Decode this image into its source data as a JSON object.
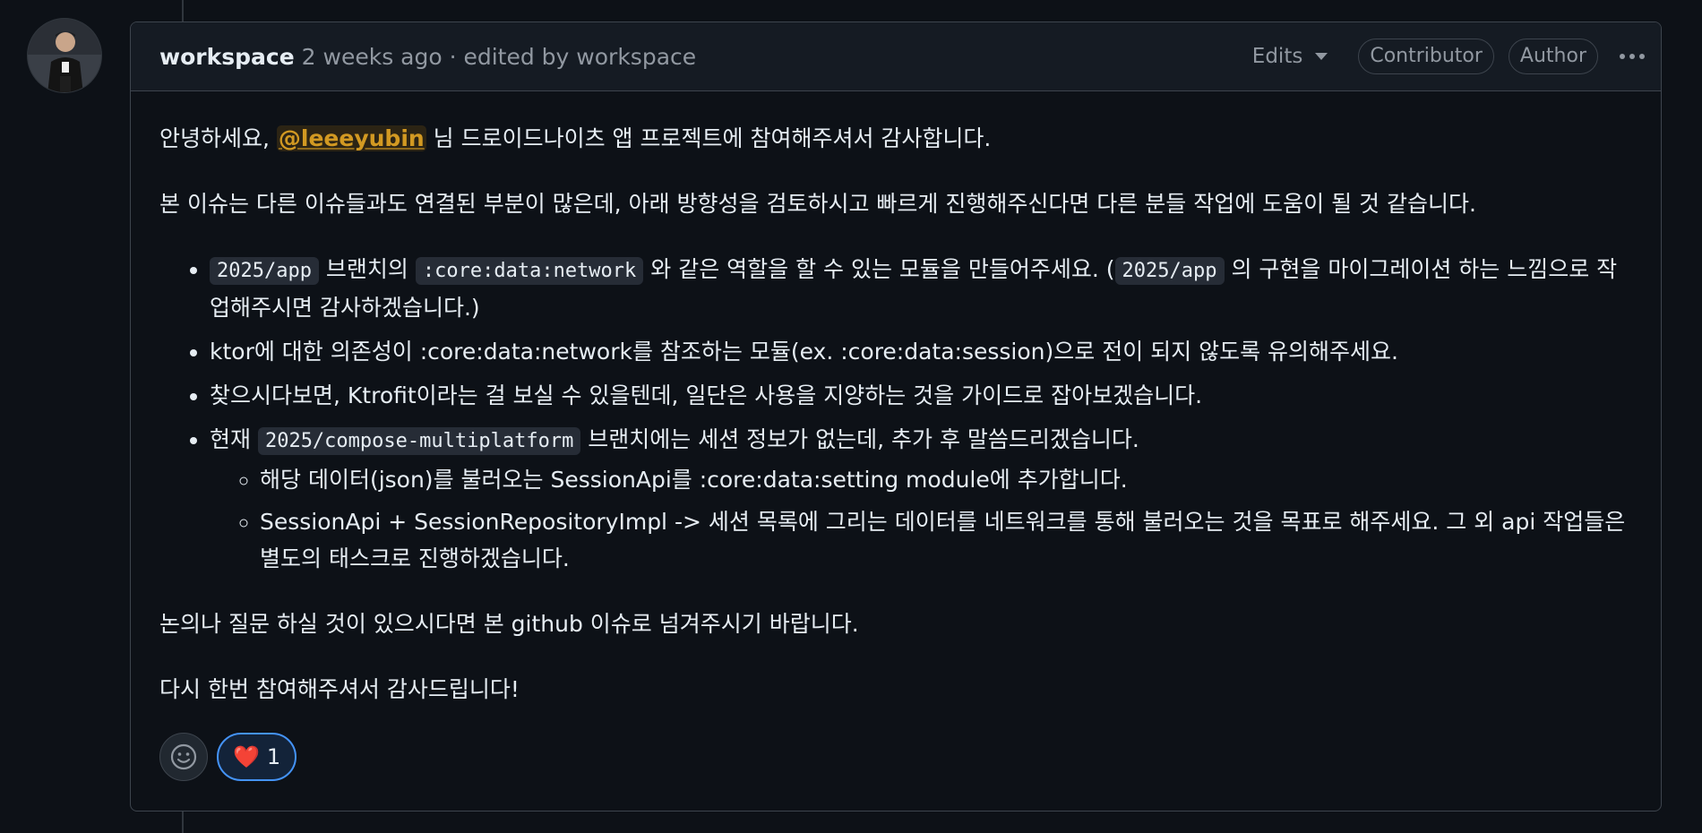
{
  "header": {
    "author": "workspace",
    "meta": "2 weeks ago · edited by workspace",
    "edits_label": "Edits",
    "badges": [
      "Contributor",
      "Author"
    ]
  },
  "body": {
    "greeting_prefix": "안녕하세요, ",
    "mention": "@leeeyubin",
    "greeting_suffix": " 님 드로이드나이츠 앱 프로젝트에 참여해주셔서 감사합니다.",
    "intro": "본 이슈는 다른 이슈들과도 연결된 부분이 많은데, 아래 방향성을 검토하시고 빠르게 진행해주신다면 다른 분들 작업에 도움이 될 것 같습니다.",
    "item1": {
      "code1": "2025/app",
      "text1": " 브랜치의 ",
      "code2": ":core:data:network",
      "text2": " 와 같은 역할을 할 수 있는 모듈을 만들어주세요. (",
      "code3": "2025/app",
      "text3": " 의 구현을 마이그레이션 하는 느낌으로 작업해주시면 감사하겠습니다.)"
    },
    "item2": "ktor에 대한 의존성이 :core:data:network를 참조하는 모듈(ex. :core:data:session)으로 전이 되지 않도록 유의해주세요.",
    "item3": "찾으시다보면, Ktrofit이라는 걸 보실 수 있을텐데, 일단은 사용을 지양하는 것을 가이드로 잡아보겠습니다.",
    "item4": {
      "text1": "현재 ",
      "code": "2025/compose-multiplatform",
      "text2": " 브랜치에는 세션 정보가 없는데, 추가 후 말씀드리겠습니다.",
      "sub": [
        "해당 데이터(json)를 불러오는 SessionApi를 :core:data:setting module에 추가합니다.",
        "SessionApi + SessionRepositoryImpl -> 세션 목록에 그리는 데이터를 네트워크를 통해 불러오는 것을 목표로 해주세요. 그 외 api 작업들은 별도의 태스크로 진행하겠습니다."
      ]
    },
    "discussion": "논의나 질문 하실 것이 있으시다면 본 github 이슈로 넘겨주시기 바랍니다.",
    "thanks": "다시 한번 참여해주셔서 감사드립니다!"
  },
  "reactions": {
    "heart_emoji": "❤️",
    "heart_count": "1"
  }
}
